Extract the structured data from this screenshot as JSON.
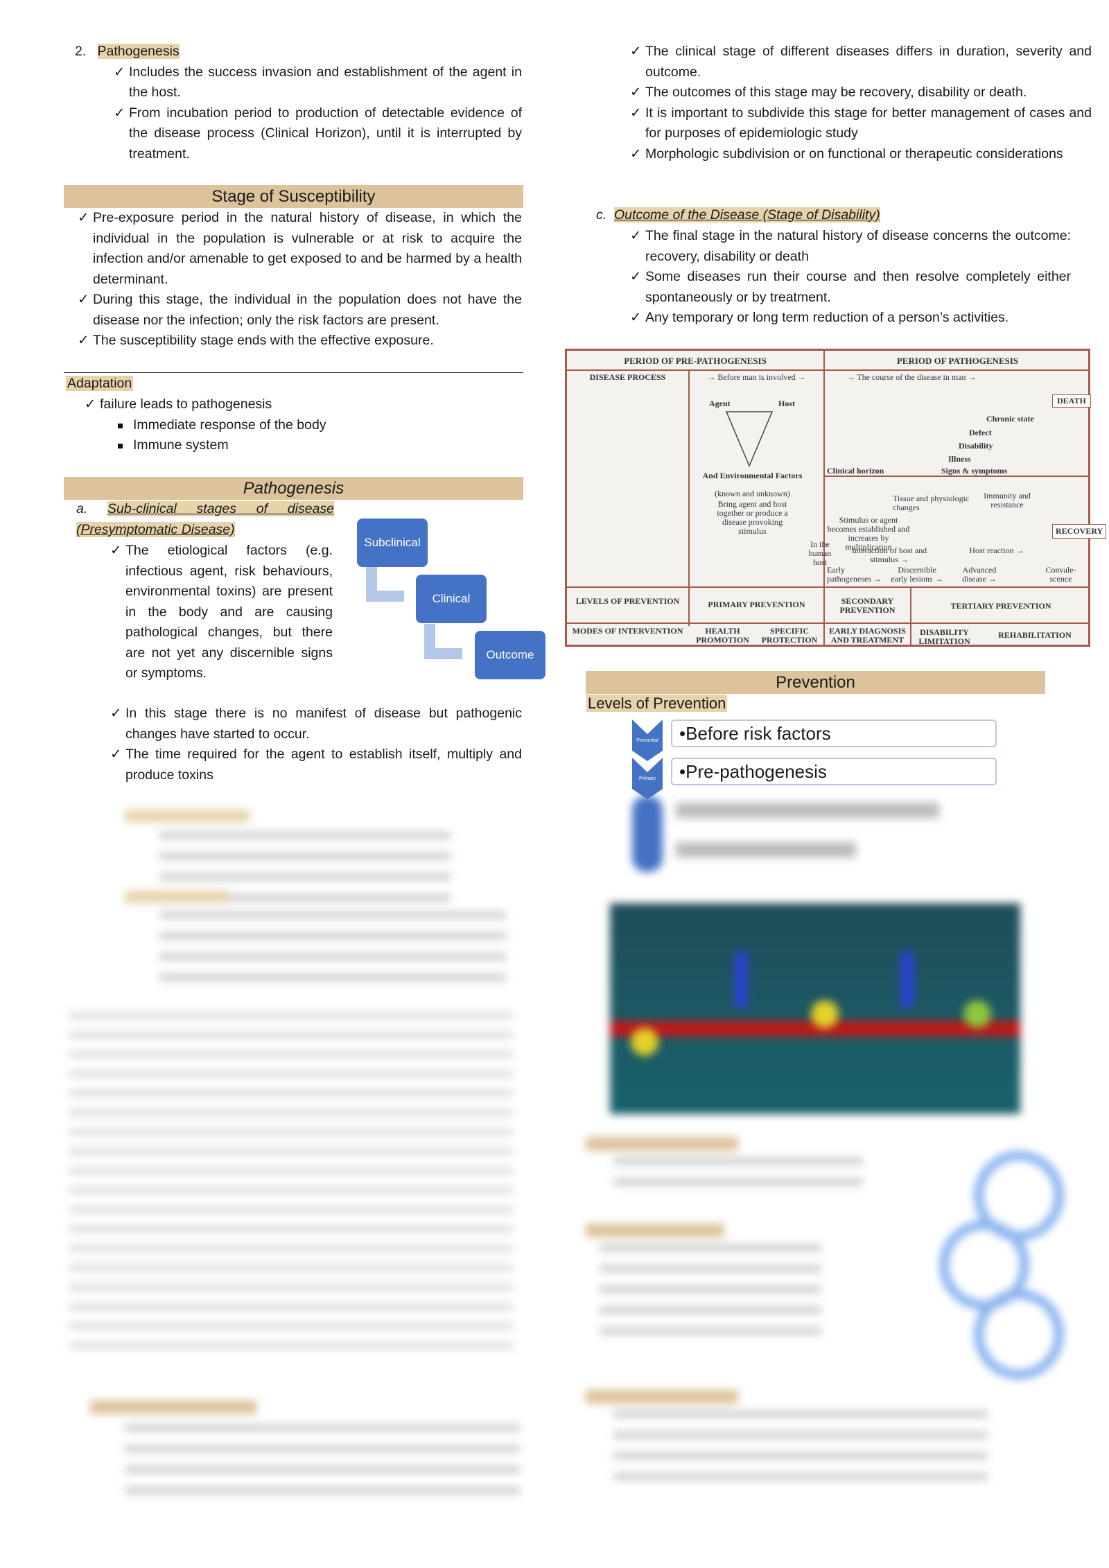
{
  "left": {
    "pathogenesis_num": "2.",
    "pathogenesis_title": "Pathogenesis",
    "pathogenesis_items": [
      "Includes the success invasion and establishment of the agent in the host.",
      "From incubation period to production of detectable evidence of the disease process (Clinical Horizon), until it is interrupted by treatment."
    ],
    "susceptibility_header": "Stage of Susceptibility",
    "susceptibility_items": [
      "Pre-exposure period in the natural history of disease, in which the individual in the population is vulnerable or at risk to acquire the infection and/or amenable to get exposed to and be harmed by a health determinant.",
      "During this stage, the individual in the population does not have the disease nor the infection; only the risk factors are present.",
      "The susceptibility stage ends with the effective exposure."
    ],
    "adaptation_title": "Adaptation",
    "adaptation_item": "failure leads to pathogenesis",
    "adaptation_subitems": [
      "Immediate response of the body",
      "Immune system"
    ],
    "pathogenesis_header": "Pathogenesis",
    "subclinical_letter": "a.",
    "subclinical_title": "Sub-clinical stages of disease (Presymptomatic Disease)",
    "subclinical_items": [
      "The etiological factors (e.g. infectious agent, risk behaviours, environmental toxins) are present in the body and are causing pathological changes, but there are not yet any discernible signs or symptoms.",
      "In this stage there is no manifest of disease but pathogenic changes have started to occur.",
      "The time required for the agent to establish itself, multiply and produce toxins"
    ],
    "flow": [
      "Subclinical",
      "Clinical",
      "Outcome"
    ]
  },
  "right": {
    "clinical_items": [
      "The clinical stage of different diseases differs in duration, severity and outcome.",
      "The outcomes of this stage may be recovery, disability or death.",
      "It is important to subdivide this stage for better management of cases and for purposes of epidemiologic study",
      "Morphologic subdivision or on functional or therapeutic considerations"
    ],
    "outcome_letter": "c.",
    "outcome_title": "Outcome of the Disease (Stage of Disability)",
    "outcome_items": [
      "The final stage in the natural history of disease concerns the outcome: recovery, disability or death",
      "Some diseases run their course and then resolve completely either spontaneously or by treatment.",
      "Any temporary or long term reduction of a person’s activities."
    ],
    "prevention_header": "Prevention",
    "levels_title": "Levels of Prevention",
    "levels": [
      {
        "tag": "Primordial",
        "text": "•Before risk factors"
      },
      {
        "tag": "Primary",
        "text": "•Pre-pathogenesis"
      }
    ]
  },
  "diagram": {
    "pre": "PERIOD OF PRE-PATHOGENESIS",
    "path": "PERIOD OF PATHOGENESIS",
    "process": "DISEASE PROCESS",
    "before": "→ Before man is involved →",
    "course": "→ The course of the disease in man →",
    "agent": "Agent",
    "host": "Host",
    "env": "And Environmental Factors",
    "known": "(known and unknown)",
    "bring": "Bring agent and host together or produce a disease provoking stimulus",
    "death": "DEATH",
    "chronic": "Chronic state",
    "defect": "Defect",
    "disability": "Disability",
    "illness": "Illness",
    "signs": "Signs & symptoms",
    "horizon": "Clinical horizon",
    "tissue": "Tissue and physiologic changes",
    "immunity": "Immunity and resistance",
    "stimulus": "Stimulus or agent becomes established and increases by multiplication",
    "recovery": "RECOVERY",
    "human": "In the human host",
    "interaction": "Interaction of host and stimulus →",
    "reaction": "Host reaction →",
    "early": "Early pathogeneses →",
    "lesions": "Discernible early lesions →",
    "advanced": "Advanced disease →",
    "conval": "Convale-scence",
    "levels": "LEVELS OF PREVENTION",
    "primary": "PRIMARY PREVENTION",
    "secondary": "SECONDARY PREVENTION",
    "tertiary": "TERTIARY PREVENTION",
    "modes": "MODES OF INTERVENTION",
    "health": "HEALTH PROMOTION",
    "specific": "SPECIFIC PROTECTION",
    "earlydx": "EARLY DIAGNOSIS AND TREATMENT",
    "limit": "DISABILITY LIMITATION",
    "rehab": "REHABILITATION"
  }
}
